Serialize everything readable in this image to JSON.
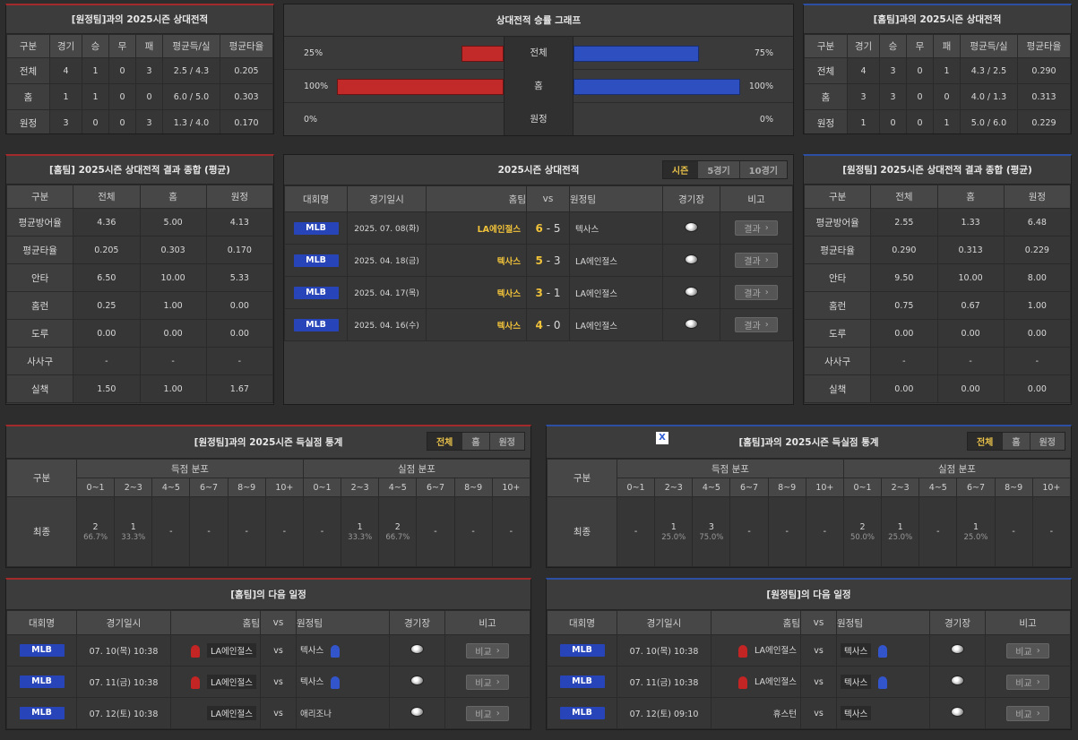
{
  "h2h_away": {
    "title": "[원정팀]과의 2025시즌 상대전적",
    "headers": [
      "구분",
      "경기",
      "승",
      "무",
      "패",
      "평균득/실",
      "평균타율"
    ],
    "rows": [
      [
        "전체",
        "4",
        "1",
        "0",
        "3",
        "2.5 / 4.3",
        "0.205"
      ],
      [
        "홈",
        "1",
        "1",
        "0",
        "0",
        "6.0 / 5.0",
        "0.303"
      ],
      [
        "원정",
        "3",
        "0",
        "0",
        "3",
        "1.3 / 4.0",
        "0.170"
      ]
    ]
  },
  "graph": {
    "title": "상대전적 승률 그래프",
    "rows": [
      {
        "label": "전체",
        "left_text": "25%",
        "right_text": "75%",
        "left": 0.25,
        "right": 0.75
      },
      {
        "label": "홈",
        "left_text": "100%",
        "right_text": "100%",
        "left": 1.0,
        "right": 1.0
      },
      {
        "label": "원정",
        "left_text": "0%",
        "right_text": "0%",
        "left": 0,
        "right": 0
      }
    ]
  },
  "h2h_home": {
    "title": "[홈팀]과의 2025시즌 상대전적",
    "headers": [
      "구분",
      "경기",
      "승",
      "무",
      "패",
      "평균득/실",
      "평균타율"
    ],
    "rows": [
      [
        "전체",
        "4",
        "3",
        "0",
        "1",
        "4.3 / 2.5",
        "0.290"
      ],
      [
        "홈",
        "3",
        "3",
        "0",
        "0",
        "4.0 / 1.3",
        "0.313"
      ],
      [
        "원정",
        "1",
        "0",
        "0",
        "1",
        "5.0 / 6.0",
        "0.229"
      ]
    ]
  },
  "sum_home": {
    "title": "[홈팀] 2025시즌 상대전적 결과 종합 (평균)",
    "headers": [
      "구분",
      "전체",
      "홈",
      "원정"
    ],
    "rows": [
      [
        "평균방어율",
        "4.36",
        "5.00",
        "4.13"
      ],
      [
        "평균타율",
        "0.205",
        "0.303",
        "0.170"
      ],
      [
        "안타",
        "6.50",
        "10.00",
        "5.33"
      ],
      [
        "홈런",
        "0.25",
        "1.00",
        "0.00"
      ],
      [
        "도루",
        "0.00",
        "0.00",
        "0.00"
      ],
      [
        "사사구",
        "-",
        "-",
        "-"
      ],
      [
        "실책",
        "1.50",
        "1.00",
        "1.67"
      ]
    ]
  },
  "season": {
    "title": "2025시즌 상대전적",
    "tabs": [
      "시즌",
      "5경기",
      "10경기"
    ],
    "headers": {
      "league": "대회명",
      "date": "경기일시",
      "home": "홈팀",
      "vs": "vs",
      "away": "원정팀",
      "stadium": "경기장",
      "note": "비고"
    },
    "result_label": "결과",
    "games": [
      {
        "league": "MLB",
        "date": "2025. 07. 08(화)",
        "home": "LA에인절스",
        "hs": "6",
        "as": "5",
        "away": "텍사스",
        "home_hl": true,
        "hs_hl": true,
        "as_hl": false
      },
      {
        "league": "MLB",
        "date": "2025. 04. 18(금)",
        "home": "텍사스",
        "hs": "5",
        "as": "3",
        "away": "LA에인절스",
        "home_hl": true,
        "hs_hl": true,
        "as_hl": false
      },
      {
        "league": "MLB",
        "date": "2025. 04. 17(목)",
        "home": "텍사스",
        "hs": "3",
        "as": "1",
        "away": "LA에인절스",
        "home_hl": true,
        "hs_hl": true,
        "as_hl": false
      },
      {
        "league": "MLB",
        "date": "2025. 04. 16(수)",
        "home": "텍사스",
        "hs": "4",
        "as": "0",
        "away": "LA에인절스",
        "home_hl": true,
        "hs_hl": true,
        "as_hl": false
      }
    ]
  },
  "sum_away": {
    "title": "[원정팀] 2025시즌 상대전적 결과 종합 (평균)",
    "headers": [
      "구분",
      "전체",
      "홈",
      "원정"
    ],
    "rows": [
      [
        "평균방어율",
        "2.55",
        "1.33",
        "6.48"
      ],
      [
        "평균타율",
        "0.290",
        "0.313",
        "0.229"
      ],
      [
        "안타",
        "9.50",
        "10.00",
        "8.00"
      ],
      [
        "홈런",
        "0.75",
        "0.67",
        "1.00"
      ],
      [
        "도루",
        "0.00",
        "0.00",
        "0.00"
      ],
      [
        "사사구",
        "-",
        "-",
        "-"
      ],
      [
        "실책",
        "0.00",
        "0.00",
        "0.00"
      ]
    ]
  },
  "score_left": {
    "title": "[원정팀]과의 2025시즌 득실점 통계",
    "tabs": [
      "전체",
      "홈",
      "원정"
    ],
    "col0": "구분",
    "group1": "득점 분포",
    "group2": "실점 분포",
    "ranges": [
      "0~1",
      "2~3",
      "4~5",
      "6~7",
      "8~9",
      "10+"
    ],
    "row_label": "최종",
    "scored": [
      {
        "n": "2",
        "p": "66.7%"
      },
      {
        "n": "1",
        "p": "33.3%"
      },
      {
        "n": "-",
        "p": ""
      },
      {
        "n": "-",
        "p": ""
      },
      {
        "n": "-",
        "p": ""
      },
      {
        "n": "-",
        "p": ""
      }
    ],
    "allowed": [
      {
        "n": "-",
        "p": ""
      },
      {
        "n": "1",
        "p": "33.3%"
      },
      {
        "n": "2",
        "p": "66.7%"
      },
      {
        "n": "-",
        "p": ""
      },
      {
        "n": "-",
        "p": ""
      },
      {
        "n": "-",
        "p": ""
      }
    ]
  },
  "score_right": {
    "title": "[홈팀]과의 2025시즌 득실점 통계",
    "close_icon": "X",
    "tabs": [
      "전체",
      "홈",
      "원정"
    ],
    "col0": "구분",
    "group1": "득점 분포",
    "group2": "실점 분포",
    "ranges": [
      "0~1",
      "2~3",
      "4~5",
      "6~7",
      "8~9",
      "10+"
    ],
    "row_label": "최종",
    "scored": [
      {
        "n": "-",
        "p": ""
      },
      {
        "n": "1",
        "p": "25.0%"
      },
      {
        "n": "3",
        "p": "75.0%"
      },
      {
        "n": "-",
        "p": ""
      },
      {
        "n": "-",
        "p": ""
      },
      {
        "n": "-",
        "p": ""
      }
    ],
    "allowed": [
      {
        "n": "2",
        "p": "50.0%"
      },
      {
        "n": "1",
        "p": "25.0%"
      },
      {
        "n": "-",
        "p": ""
      },
      {
        "n": "1",
        "p": "25.0%"
      },
      {
        "n": "-",
        "p": ""
      },
      {
        "n": "-",
        "p": ""
      }
    ]
  },
  "next_home": {
    "title": "[홈팀]의 다음 일정",
    "headers": {
      "league": "대회명",
      "date": "경기일시",
      "home": "홈팀",
      "vs": "vs",
      "away": "원정팀",
      "stadium": "경기장",
      "note": "비고"
    },
    "compare_label": "비교",
    "games": [
      {
        "league": "MLB",
        "date": "07. 10(목) 10:38",
        "home": "LA에인절스",
        "away": "텍사스",
        "home_icon": true,
        "away_icon": true,
        "home_box": true,
        "away_box": false
      },
      {
        "league": "MLB",
        "date": "07. 11(금) 10:38",
        "home": "LA에인절스",
        "away": "텍사스",
        "home_icon": true,
        "away_icon": true,
        "home_box": true,
        "away_box": false
      },
      {
        "league": "MLB",
        "date": "07. 12(토) 10:38",
        "home": "LA에인절스",
        "away": "애리조나",
        "home_icon": false,
        "away_icon": false,
        "home_box": true,
        "away_box": false
      }
    ]
  },
  "next_away": {
    "title": "[원정팀]의 다음 일정",
    "headers": {
      "league": "대회명",
      "date": "경기일시",
      "home": "홈팀",
      "vs": "vs",
      "away": "원정팀",
      "stadium": "경기장",
      "note": "비고"
    },
    "compare_label": "비교",
    "games": [
      {
        "league": "MLB",
        "date": "07. 10(목) 10:38",
        "home": "LA에인절스",
        "away": "텍사스",
        "home_icon": true,
        "away_icon": true,
        "home_box": false,
        "away_box": true
      },
      {
        "league": "MLB",
        "date": "07. 11(금) 10:38",
        "home": "LA에인절스",
        "away": "텍사스",
        "home_icon": true,
        "away_icon": true,
        "home_box": false,
        "away_box": true
      },
      {
        "league": "MLB",
        "date": "07. 12(토) 09:10",
        "home": "휴스턴",
        "away": "텍사스",
        "home_icon": false,
        "away_icon": false,
        "home_box": false,
        "away_box": true
      }
    ]
  },
  "colors": {
    "accent": "#f0c23a",
    "home_bar": "#c22a2a",
    "away_bar": "#2d4fbf",
    "badge": "#2744b8"
  }
}
